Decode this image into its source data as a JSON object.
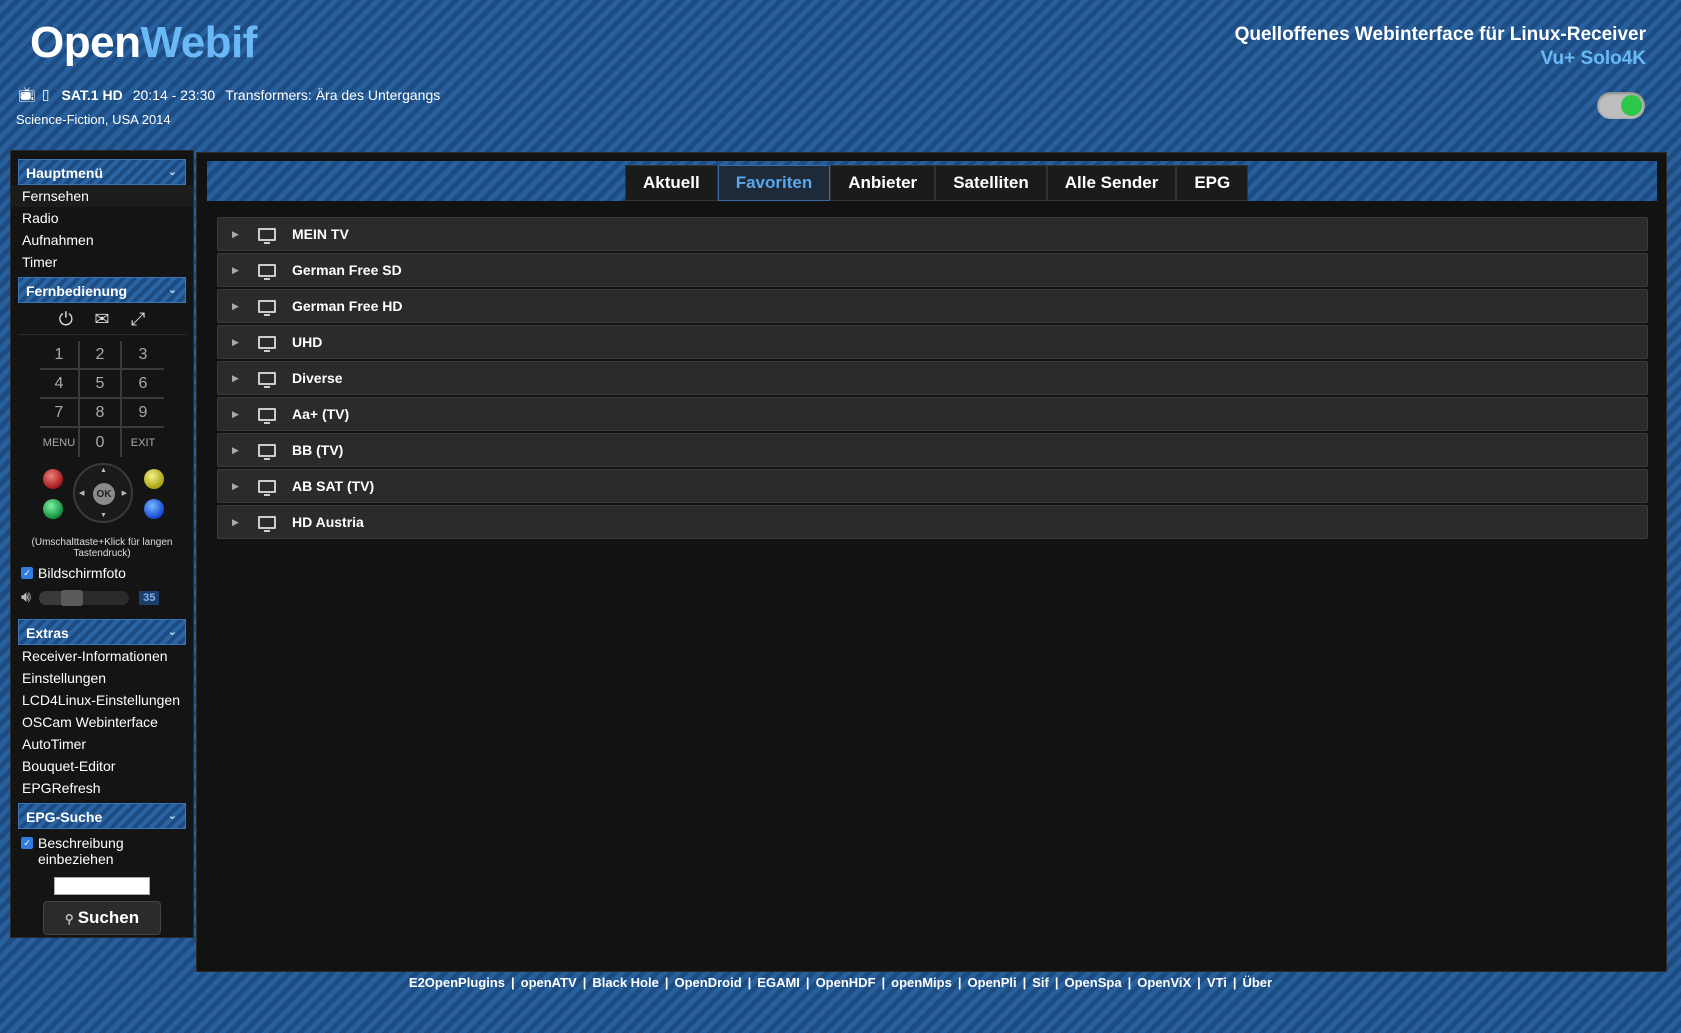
{
  "header": {
    "logo_part1": "Open",
    "logo_part2": "Webif",
    "tagline": "Quelloffenes Webinterface für Linux-Receiver",
    "device": "Vu+ Solo4K"
  },
  "now_playing": {
    "channel": "SAT.1 HD",
    "time": "20:14 - 23:30",
    "title": "Transformers: Ära des Untergangs",
    "genre": "Science-Fiction, USA 2014"
  },
  "toggle": {
    "state": "on",
    "color": "#2bc84a"
  },
  "sidebar": {
    "main_menu": {
      "title": "Hauptmenü",
      "items": [
        "Fernsehen",
        "Radio",
        "Aufnahmen",
        "Timer"
      ]
    },
    "remote": {
      "title": "Fernbedienung",
      "icons": [
        "power-icon",
        "message-icon",
        "fullscreen-icon"
      ],
      "keys": [
        "1",
        "2",
        "3",
        "4",
        "5",
        "6",
        "7",
        "8",
        "9",
        "MENU",
        "0",
        "EXIT"
      ],
      "ok_label": "OK",
      "hint": "(Umschalttaste+Klick für langen Tastendruck)",
      "screenshot_label": "Bildschirmfoto",
      "volume": "35"
    },
    "extras": {
      "title": "Extras",
      "items": [
        "Receiver-Informationen",
        "Einstellungen",
        "LCD4Linux-Einstellungen",
        "OSCam Webinterface",
        "AutoTimer",
        "Bouquet-Editor",
        "EPGRefresh"
      ]
    },
    "epg_search": {
      "title": "EPG-Suche",
      "include_desc_label": "Beschreibung einbeziehen",
      "search_value": "",
      "search_button": "Suchen"
    }
  },
  "tabs": [
    "Aktuell",
    "Favoriten",
    "Anbieter",
    "Satelliten",
    "Alle Sender",
    "EPG"
  ],
  "active_tab": "Favoriten",
  "bouquets": [
    "MEIN TV",
    "German Free SD",
    "German Free HD",
    "UHD",
    "Diverse",
    "Aa+ (TV)",
    "BB (TV)",
    "AB SAT (TV)",
    "HD Austria"
  ],
  "footer_links": [
    "E2OpenPlugins",
    "openATV",
    "Black Hole",
    "OpenDroid",
    "EGAMI",
    "OpenHDF",
    "openMips",
    "OpenPli",
    "Sif",
    "OpenSpa",
    "OpenViX",
    "VTi",
    "Über"
  ],
  "colors": {
    "accent": "#6ab8f5",
    "active_tab": "#5aa7ee",
    "background_stripe": "#1d4c82"
  }
}
